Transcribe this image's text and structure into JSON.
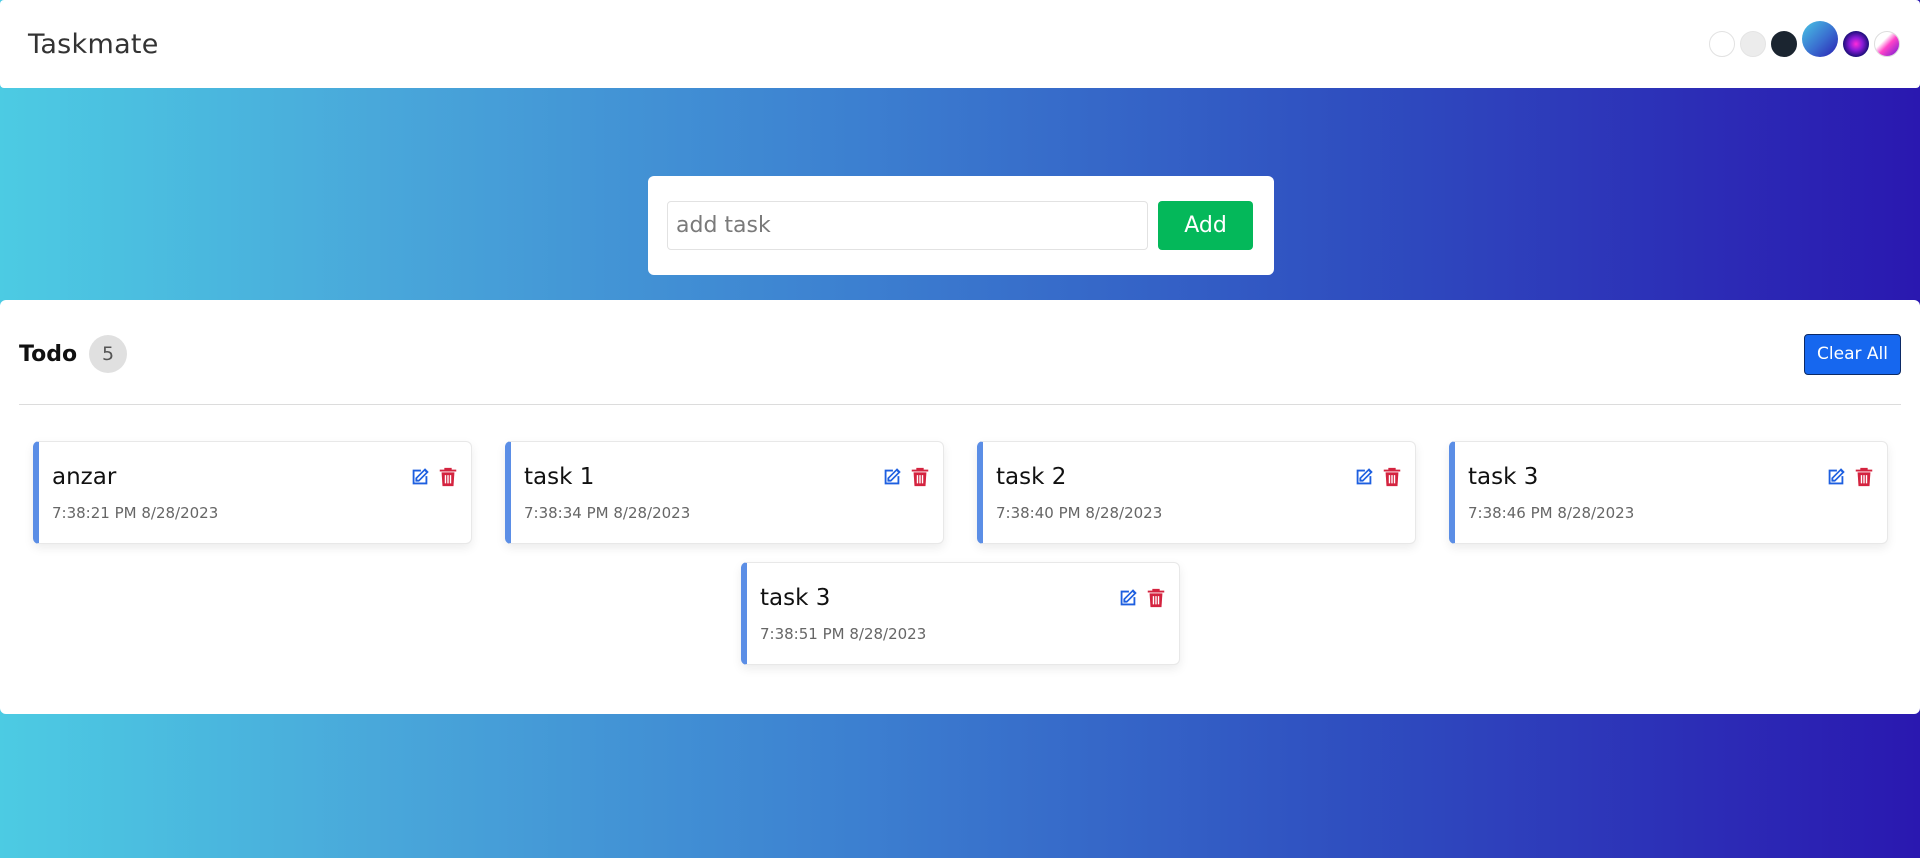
{
  "header": {
    "brand": "Taskmate",
    "theme_options": [
      "white-theme",
      "light-theme",
      "dark-theme",
      "blue-gradient-theme",
      "purple-theme",
      "pink-theme"
    ]
  },
  "form": {
    "placeholder": "add task",
    "value": "",
    "add_label": "Add"
  },
  "todo": {
    "title": "Todo",
    "count": "5",
    "clear_label": "Clear All",
    "tasks": [
      {
        "name": "anzar",
        "time": "7:38:21 PM 8/28/2023"
      },
      {
        "name": "task 1",
        "time": "7:38:34 PM 8/28/2023"
      },
      {
        "name": "task 2",
        "time": "7:38:40 PM 8/28/2023"
      },
      {
        "name": "task 3",
        "time": "7:38:46 PM 8/28/2023"
      },
      {
        "name": "task 3",
        "time": "7:38:51 PM 8/28/2023"
      }
    ]
  },
  "colors": {
    "accent_border": "#5b8ee6",
    "add_button": "#04b85a",
    "clear_button": "#1667ef",
    "edit_icon": "#1d5fe0",
    "delete_icon": "#d4233f"
  }
}
